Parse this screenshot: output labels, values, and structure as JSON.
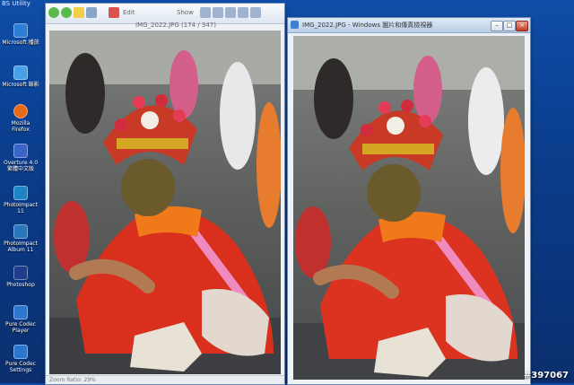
{
  "desktop": {
    "utility_label": "BS Utility",
    "icons": [
      {
        "label": "Microsoft 播放",
        "color": "#2d7fd6"
      },
      {
        "label": "Microsoft 錄影",
        "color": "#4aa0e6"
      },
      {
        "label": "Mozilla Firefox",
        "color": "#e66a1a"
      },
      {
        "label": "Overture 4.0 繁體中文版",
        "color": "#3a66c7"
      },
      {
        "label": "PhotoImpact 11",
        "color": "#1f86c6"
      },
      {
        "label": "PhotoImpact Album 11",
        "color": "#2a76bb"
      },
      {
        "label": "Photoshop",
        "color": "#1f3e8a"
      },
      {
        "label": "Pure Codec Player",
        "color": "#2e77d0"
      },
      {
        "label": "Pure Codec Settings",
        "color": "#2e77d0"
      }
    ]
  },
  "left_window": {
    "toolbar_title": "IMG_2022.JPG (174 / 347)",
    "edit_label": "Edit",
    "show_label": "Show",
    "status": "Zoom Ratio: 29%"
  },
  "right_window": {
    "title": "IMG_2022.JPG - Windows 圖片和傳真檢視器",
    "minimize_glyph": "–",
    "maximize_glyph": "□",
    "close_glyph": "×"
  },
  "watermark": "#397067"
}
